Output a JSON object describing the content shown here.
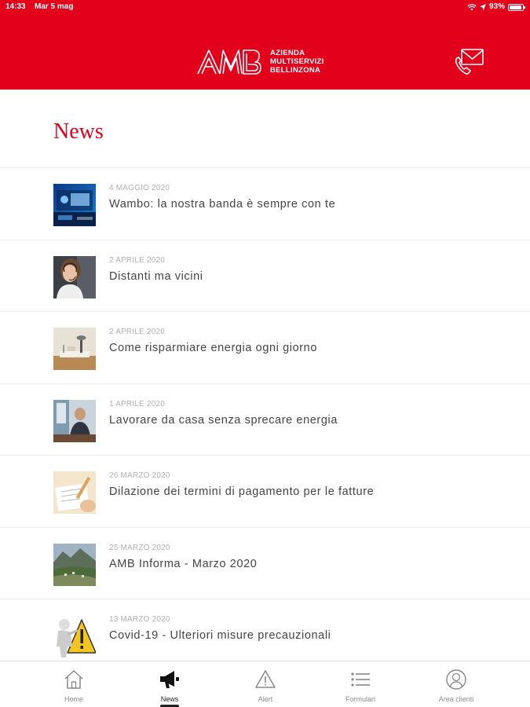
{
  "status_bar": {
    "time": "14:33",
    "date": "Mar 5 mag",
    "battery": "93%",
    "battery_level": 0.93,
    "icons": [
      "wifi-icon",
      "location-icon",
      "battery-icon"
    ]
  },
  "header": {
    "logo_mark": "AMB",
    "logo_lines": [
      "AZIENDA",
      "MULTISERVIZI",
      "BELLINZONA"
    ],
    "contact_icon": "mail-phone-icon",
    "background_color": "#e2001a"
  },
  "page": {
    "title": "News",
    "accent_color": "#e2001a"
  },
  "news": [
    {
      "date": "4 MAGGIO 2020",
      "title": "Wambo: la nostra banda è sempre con te",
      "thumbnail": "thumbnail-wambo"
    },
    {
      "date": "2 APRILE 2020",
      "title": "Distanti ma vicini",
      "thumbnail": "thumbnail-call-center"
    },
    {
      "date": "2 APRILE 2020",
      "title": "Come risparmiare energia ogni giorno",
      "thumbnail": "thumbnail-energy-desk"
    },
    {
      "date": "1 APRILE 2020",
      "title": "Lavorare da casa senza sprecare energia",
      "thumbnail": "thumbnail-home-office"
    },
    {
      "date": "26 MARZO 2020",
      "title": "Dilazione dei termini di pagamento per le fatture",
      "thumbnail": "thumbnail-invoice"
    },
    {
      "date": "25 MARZO 2020",
      "title": "AMB Informa - Marzo 2020",
      "thumbnail": "thumbnail-valley"
    },
    {
      "date": "13 MARZO 2020",
      "title": "Covid-19 - Ulteriori misure precauzionali",
      "thumbnail": "thumbnail-warning"
    }
  ],
  "tabs": [
    {
      "label": "Home",
      "icon": "home-icon",
      "active": false
    },
    {
      "label": "News",
      "icon": "megaphone-icon",
      "active": true
    },
    {
      "label": "Alert",
      "icon": "alert-triangle-icon",
      "active": false
    },
    {
      "label": "Formulari",
      "icon": "list-icon",
      "active": false
    },
    {
      "label": "Area clienti",
      "icon": "user-circle-icon",
      "active": false
    }
  ]
}
